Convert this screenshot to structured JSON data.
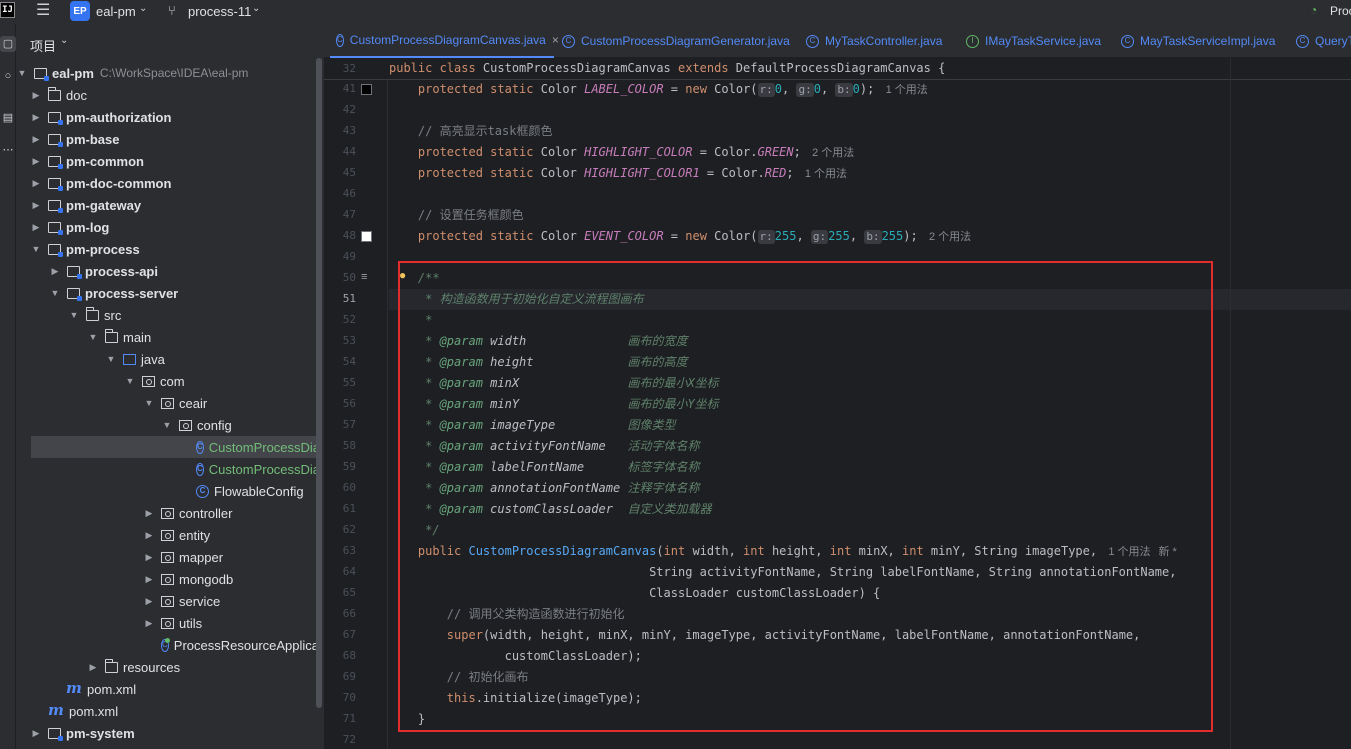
{
  "titlebar": {
    "logo": "IJ",
    "project_badge": "EP",
    "project_name": "eal-pm",
    "branch": "process-11",
    "run_config": "Proc"
  },
  "project_panel": {
    "title": "项目",
    "root_name": "eal-pm",
    "root_path": "C:\\WorkSpace\\IDEA\\eal-pm",
    "items": [
      {
        "label": "doc"
      },
      {
        "label": "pm-authorization"
      },
      {
        "label": "pm-base"
      },
      {
        "label": "pm-common"
      },
      {
        "label": "pm-doc-common"
      },
      {
        "label": "pm-gateway"
      },
      {
        "label": "pm-log"
      },
      {
        "label": "pm-process"
      },
      {
        "label": "process-api"
      },
      {
        "label": "process-server"
      },
      {
        "label": "src"
      },
      {
        "label": "main"
      },
      {
        "label": "java"
      },
      {
        "label": "com"
      },
      {
        "label": "ceair"
      },
      {
        "label": "config"
      },
      {
        "label": "CustomProcessDiagramCanvas"
      },
      {
        "label": "CustomProcessDiagramGenerator"
      },
      {
        "label": "FlowableConfig"
      },
      {
        "label": "controller"
      },
      {
        "label": "entity"
      },
      {
        "label": "mapper"
      },
      {
        "label": "mongodb"
      },
      {
        "label": "service"
      },
      {
        "label": "utils"
      },
      {
        "label": "ProcessResourceApplication"
      },
      {
        "label": "resources"
      },
      {
        "label": "pom.xml"
      },
      {
        "label": "pom.xml"
      },
      {
        "label": "pm-system"
      }
    ]
  },
  "tabs": [
    {
      "label": "CustomProcessDiagramCanvas.java",
      "icon": "C"
    },
    {
      "label": "CustomProcessDiagramGenerator.java",
      "icon": "C"
    },
    {
      "label": "MyTaskController.java",
      "icon": "C"
    },
    {
      "label": "IMayTaskService.java",
      "icon": "I"
    },
    {
      "label": "MayTaskServiceImpl.java",
      "icon": "C"
    },
    {
      "label": "QueryT",
      "icon": "C"
    }
  ],
  "editor": {
    "sticky_line_number": "32",
    "sticky_text": "public class CustomProcessDiagramCanvas extends DefaultProcessDiagramCanvas {",
    "line_numbers": [
      "41",
      "42",
      "43",
      "44",
      "45",
      "46",
      "47",
      "48",
      "49",
      "50",
      "51",
      "52",
      "53",
      "54",
      "55",
      "56",
      "57",
      "58",
      "59",
      "60",
      "61",
      "62",
      "63",
      "64",
      "65",
      "66",
      "67",
      "68",
      "69",
      "70",
      "71",
      "72"
    ],
    "usages": {
      "one": "1 个用法",
      "two": "2 个用法",
      "new": "新 *"
    },
    "comments": {
      "highlight": "// 高亮显示task框颜色",
      "event": "// 设置任务框颜色",
      "call_parent": "// 调用父类构造函数进行初始化",
      "init": "// 初始化画布"
    },
    "javadoc": {
      "open": "/**",
      "summary": "* 构造函数用于初始化自定义流程图画布",
      "star": "*",
      "close": "*/",
      "params": [
        {
          "name": "width",
          "desc": "画布的宽度"
        },
        {
          "name": "height",
          "desc": "画布的高度"
        },
        {
          "name": "minX",
          "desc": "画布的最小X坐标"
        },
        {
          "name": "minY",
          "desc": "画布的最小Y坐标"
        },
        {
          "name": "imageType",
          "desc": "图像类型"
        },
        {
          "name": "activityFontName",
          "desc": "活动字体名称"
        },
        {
          "name": "labelFontName",
          "desc": "标签字体名称"
        },
        {
          "name": "annotationFontName",
          "desc": "注释字体名称"
        },
        {
          "name": "customClassLoader",
          "desc": "自定义类加载器"
        }
      ]
    },
    "swatch_colors": {
      "label": "#000000",
      "event": "#ffffff"
    }
  }
}
